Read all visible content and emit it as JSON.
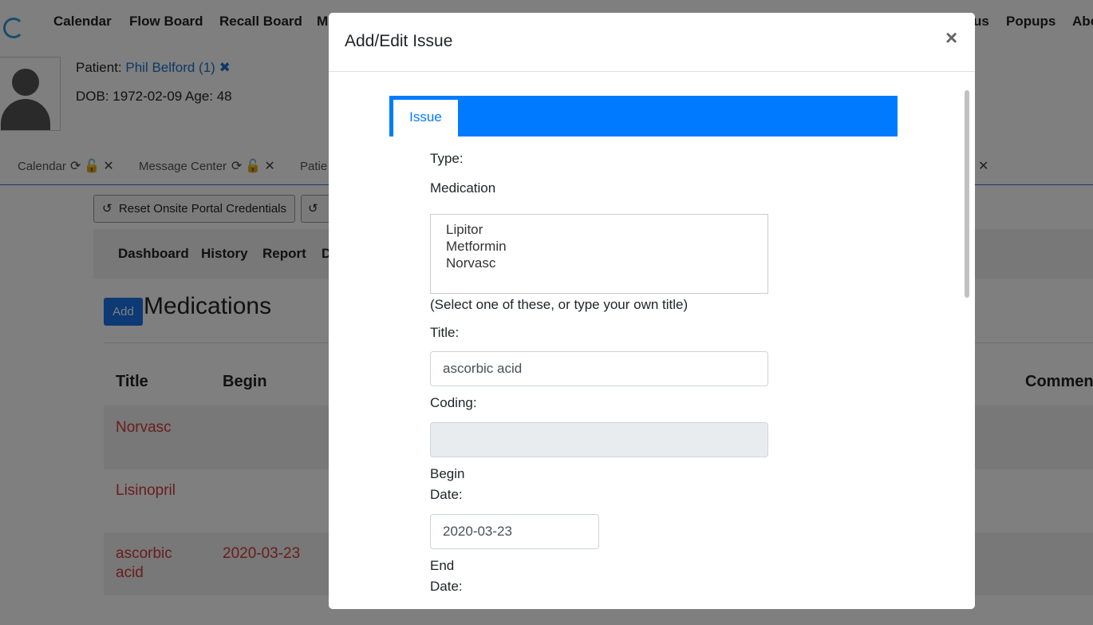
{
  "nav": {
    "items": [
      "Calendar",
      "Flow Board",
      "Recall Board",
      "M",
      "us",
      "Popups",
      "Abo"
    ]
  },
  "patient": {
    "patient_label": "Patient:",
    "name": "Phil Belford (1)",
    "remove_icon": "✖",
    "dob_line": "DOB: 1972-02-09 Age: 48"
  },
  "tabs": {
    "items": [
      {
        "label": "Calendar"
      },
      {
        "label": "Message Center"
      },
      {
        "label": "Patie"
      }
    ],
    "far_close": "✕"
  },
  "toolbar": {
    "reset_label": "Reset Onsite Portal Credentials"
  },
  "subnav": {
    "items": [
      "Dashboard",
      "History",
      "Report",
      "D"
    ]
  },
  "medications": {
    "add_label": "Add",
    "title": "Medications",
    "columns": [
      "Title",
      "Begin",
      "Comment"
    ],
    "rows": [
      {
        "title": "Norvasc",
        "begin": ""
      },
      {
        "title": "Lisinopril",
        "begin": ""
      },
      {
        "title": "ascorbic\nacid",
        "begin": "2020-03-23"
      }
    ]
  },
  "modal": {
    "title": "Add/Edit Issue",
    "close": "×",
    "tab_label": "Issue",
    "type_label": "Type:",
    "type_value": "Medication",
    "list_options": [
      "Lipitor",
      "Metformin",
      "Norvasc"
    ],
    "list_hint": "(Select one of these, or type your own title)",
    "title_label": "Title:",
    "title_value": "ascorbic acid",
    "coding_label": "Coding:",
    "coding_value": "",
    "begin_label_1": "Begin",
    "begin_label_2": "Date:",
    "begin_value": "2020-03-23",
    "end_label_1": "End",
    "end_label_2": "Date:"
  },
  "colors": {
    "primary": "#007bff",
    "link": "#1a73c8",
    "danger_text": "#d43a3a",
    "overlay": "rgba(0,0,0,0.5)"
  }
}
